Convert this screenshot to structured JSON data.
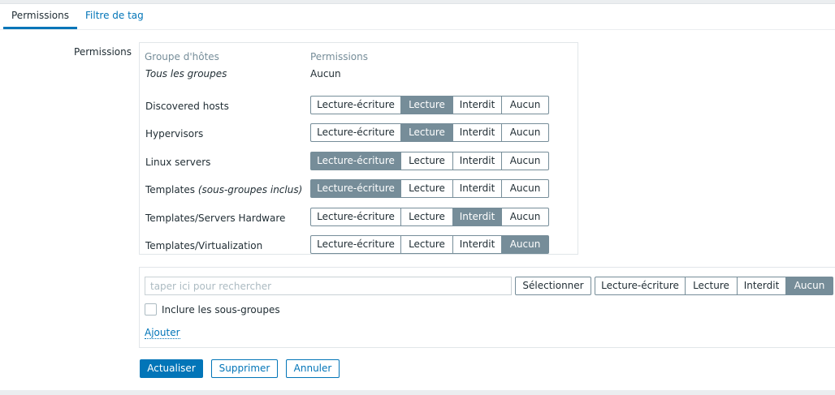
{
  "tabs": [
    {
      "label": "Permissions",
      "active": true
    },
    {
      "label": "Filtre de tag",
      "active": false
    }
  ],
  "form": {
    "permissions_label": "Permissions"
  },
  "table": {
    "col_group": "Groupe d'hôtes",
    "col_permissions": "Permissions",
    "all_groups_label": "Tous les groupes",
    "all_groups_value": "Aucun",
    "rows": [
      {
        "name": "Discovered hosts",
        "suffix": "",
        "selected": "Lecture"
      },
      {
        "name": "Hypervisors",
        "suffix": "",
        "selected": "Lecture"
      },
      {
        "name": "Linux servers",
        "suffix": "",
        "selected": "Lecture-écriture"
      },
      {
        "name": "Templates",
        "suffix": "(sous-groupes inclus)",
        "selected": "Lecture-écriture"
      },
      {
        "name": "Templates/Servers Hardware",
        "suffix": "",
        "selected": "Interdit"
      },
      {
        "name": "Templates/Virtualization",
        "suffix": "",
        "selected": "Aucun"
      }
    ]
  },
  "options": [
    "Lecture-écriture",
    "Lecture",
    "Interdit",
    "Aucun"
  ],
  "add_section": {
    "search_placeholder": "taper ici pour rechercher",
    "select_button": "Sélectionner",
    "selected": "Aucun",
    "include_subgroups_label": "Inclure les sous-groupes",
    "include_subgroups_checked": false,
    "add_link": "Ajouter"
  },
  "actions": {
    "update": "Actualiser",
    "delete": "Supprimer",
    "cancel": "Annuler"
  },
  "colors": {
    "accent": "#0275b8",
    "toggle_on": "#768d99"
  }
}
